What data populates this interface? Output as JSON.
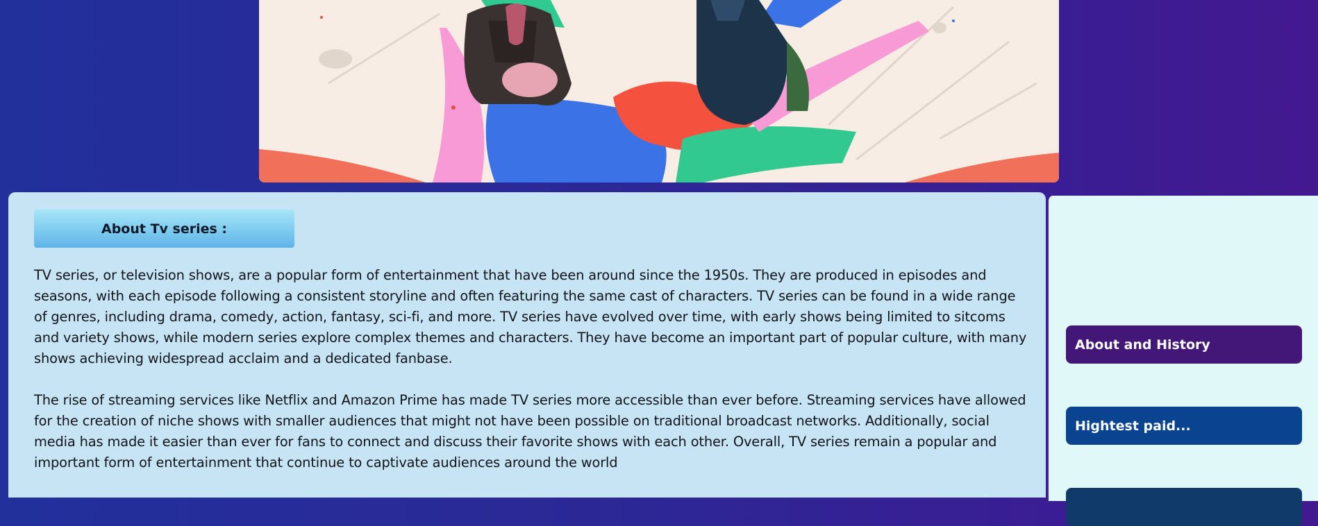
{
  "hero": {
    "alt": "TV series banner artwork"
  },
  "main": {
    "section_title": "About Tv series :",
    "paragraphs": [
      "TV series, or television shows, are a popular form of entertainment that have been around since the 1950s. They are produced in episodes and seasons, with each episode following a consistent storyline and often featuring the same cast of characters. TV series can be found in a wide range of genres, including drama, comedy, action, fantasy, sci-fi, and more. TV series have evolved over time, with early shows being limited to sitcoms and variety shows, while modern series explore complex themes and characters. They have become an important part of popular culture, with many shows achieving widespread acclaim and a dedicated fanbase.",
      "The rise of streaming services like Netflix and Amazon Prime has made TV series more accessible than ever before. Streaming services have allowed for the creation of niche shows with smaller audiences that might not have been possible on traditional broadcast networks. Additionally, social media has made it easier than ever for fans to connect and discuss their favorite shows with each other. Overall, TV series remain a popular and important form of entertainment that continue to captivate audiences around the world"
    ]
  },
  "sidebar": {
    "buttons": [
      {
        "label": "About and History",
        "color": "#431778"
      },
      {
        "label": "Hightest paid...",
        "color": "#0a4490"
      },
      {
        "label": "",
        "color": "#0f3a6a"
      }
    ]
  },
  "colors": {
    "page_bg_left": "#22309c",
    "page_bg_right": "#43198f",
    "content_bg": "#c7e4f5",
    "sidebar_bg": "#e1f8f8"
  }
}
